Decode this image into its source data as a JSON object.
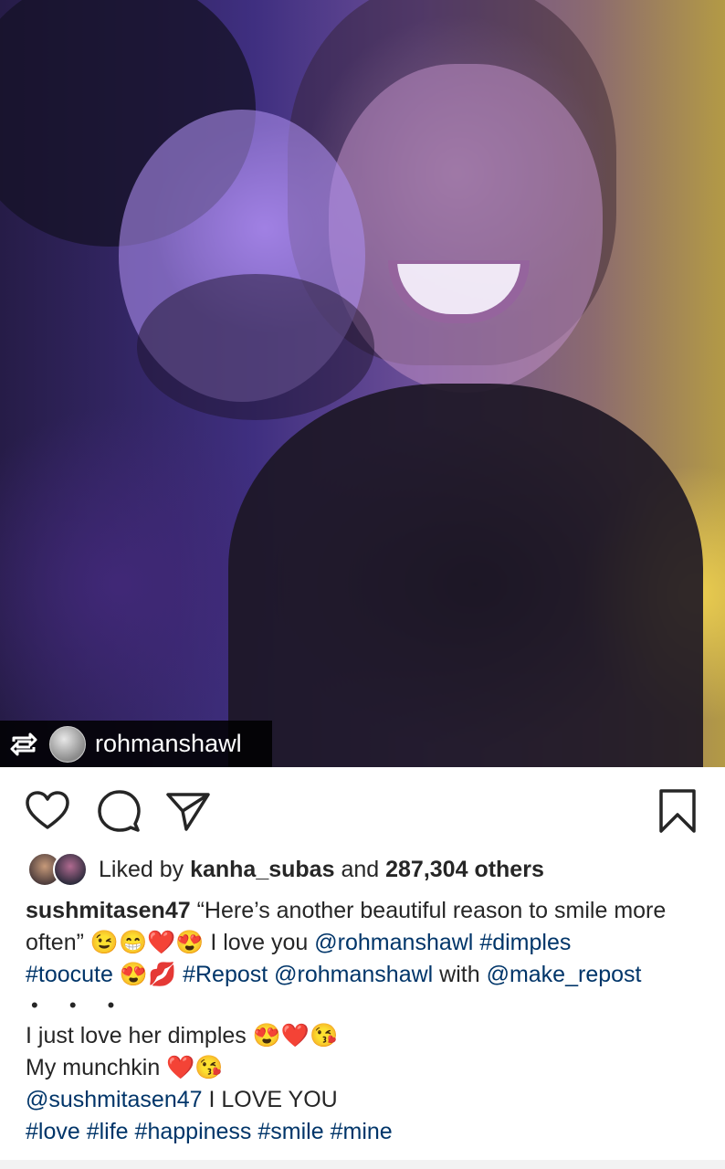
{
  "repost_badge": {
    "icon": "repost-icon",
    "username": "rohmanshawl"
  },
  "actions": {
    "like_icon": "heart-icon",
    "comment_icon": "comment-icon",
    "share_icon": "paper-plane-icon",
    "save_icon": "bookmark-icon"
  },
  "likes": {
    "prefix": "Liked by",
    "liker": "kanha_subas",
    "middle": "and",
    "count": "287,304 others"
  },
  "caption": {
    "author": "sushmitasen47",
    "line1_text": " “Here’s another beautiful reason to smile more",
    "line2_text": "often” 😉😁❤️😍 I love you ",
    "mention_rohman": "@rohmanshawl",
    "tag_dimples": "#dimples",
    "tag_toocute": "#toocute",
    "emoji_toocute": " 😍💋 ",
    "tag_repost": "#Repost",
    "mention_rohman2": "@rohmanshawl",
    "with_text": " with ",
    "mention_make_repost": "@make_repost",
    "dots": "• • •",
    "line5": "I just love her dimples 😍❤️😘",
    "line6": "My munchkin ❤️😘",
    "mention_sushmita": "@sushmitasen47",
    "line7_rest": " I LOVE YOU",
    "hashtags": [
      "#love",
      "#life",
      "#happiness",
      "#smile",
      "#mine"
    ]
  },
  "colors": {
    "link": "#003569",
    "text": "#262626"
  }
}
